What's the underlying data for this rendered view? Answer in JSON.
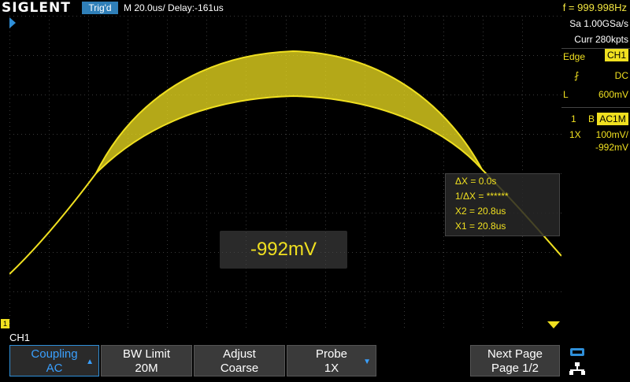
{
  "header": {
    "brand": "SIGLENT",
    "trigger_status": "Trig'd",
    "timebase": "M 20.0us/",
    "delay": "Delay:-161us",
    "frequency": "f = 999.998Hz"
  },
  "acquisition": {
    "sample_rate": "Sa 1.00GSa/s",
    "memory": "Curr 280kpts"
  },
  "trigger": {
    "type": "Edge",
    "source": "CH1",
    "coupling": "DC",
    "level_label": "L",
    "level": "600mV"
  },
  "channel": {
    "number": "1",
    "bw_flag": "B",
    "coupling_badge": "AC1M",
    "probe": "1X",
    "scale": "100mV/",
    "offset": "-992mV"
  },
  "cursors": {
    "dx": "ΔX = 0.0s",
    "inv_dx": "1/ΔX = ******",
    "x2": "X2 = 20.8us",
    "x1": "X1 = 20.8us"
  },
  "value_display": "-992mV",
  "markers": {
    "channel_marker": "1"
  },
  "menu": {
    "title": "CH1",
    "buttons": [
      {
        "label": "Coupling",
        "value": "AC",
        "active": true
      },
      {
        "label": "BW Limit",
        "value": "20M",
        "active": false
      },
      {
        "label": "Adjust",
        "value": "Coarse",
        "active": false
      },
      {
        "label": "Probe",
        "value": "1X",
        "active": false
      },
      {
        "label": "Next Page",
        "value": "Page 1/2",
        "active": false
      }
    ]
  },
  "colors": {
    "trace": "#f0e020",
    "accent": "#2f7fb8"
  }
}
